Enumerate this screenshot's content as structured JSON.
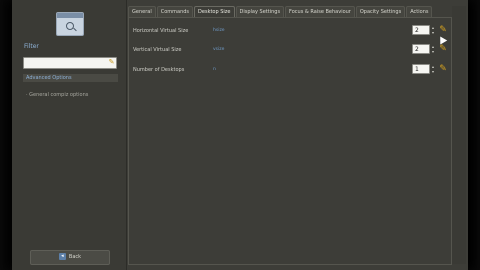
{
  "sidebar": {
    "filter_label": "Filter",
    "filter_value": "",
    "section_header": "Advanced Options",
    "plugins": [
      {
        "label": "· General compiz options"
      }
    ],
    "back_label": "Back"
  },
  "tabs": [
    {
      "label": "General",
      "active": false
    },
    {
      "label": "Commands",
      "active": false
    },
    {
      "label": "Desktop Size",
      "active": true
    },
    {
      "label": "Display Settings",
      "active": false
    },
    {
      "label": "Focus & Raise Behaviour",
      "active": false
    },
    {
      "label": "Opacity Settings",
      "active": false
    },
    {
      "label": "Actions",
      "active": false
    }
  ],
  "settings": [
    {
      "label": "Horizontal Virtual Size",
      "value_hint": "hsize",
      "value": "2"
    },
    {
      "label": "Vertical Virtual Size",
      "value_hint": "vsize",
      "value": "2"
    },
    {
      "label": "Number of Desktops",
      "value_hint": "n",
      "value": "1"
    }
  ],
  "colors": {
    "window_bg": "#3d3d38",
    "accent_blue": "#8fb3d9",
    "reset_icon": "#d6a21f"
  }
}
